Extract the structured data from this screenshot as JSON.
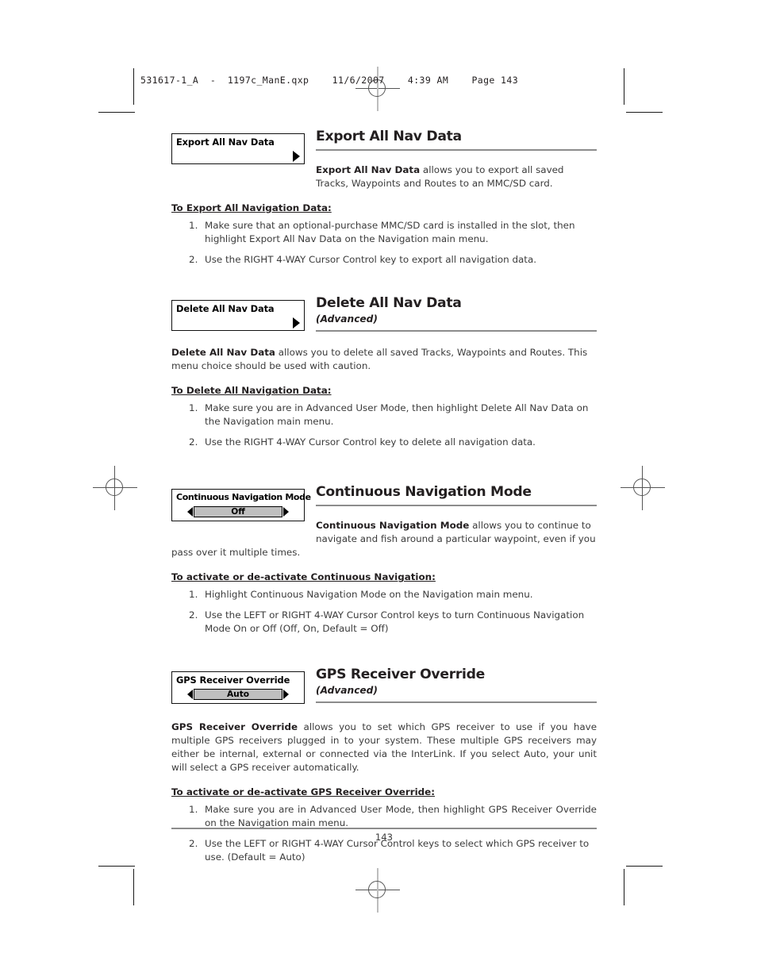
{
  "prepress": {
    "filestamp": "531617-1_A  -  1197c_ManE.qxp    11/6/2007    4:39 AM    Page 143"
  },
  "footer": {
    "page_number": "143"
  },
  "sections": [
    {
      "id": "export-all-nav-data",
      "widget": {
        "label": "Export All Nav Data",
        "type": "submenu",
        "arrow": "triangle-right"
      },
      "title": "Export All Nav Data",
      "subtitle": "",
      "body_bold": "Export All Nav Data",
      "body_rest": " allows you to export all saved Tracks, Waypoints and Routes to an MMC/SD card.",
      "howto": "To Export All Navigation Data:",
      "steps": [
        "Make sure that an optional-purchase MMC/SD card is installed in the slot, then highlight Export All Nav Data on the Navigation main menu.",
        "Use the RIGHT 4-WAY Cursor Control key to export all navigation data."
      ]
    },
    {
      "id": "delete-all-nav-data",
      "widget": {
        "label": "Delete All Nav Data",
        "type": "submenu",
        "arrow": "triangle-right"
      },
      "title": "Delete All Nav Data",
      "subtitle": "(Advanced)",
      "body_bold": "Delete All Nav Data",
      "body_rest": " allows you to delete all saved Tracks, Waypoints and Routes. This menu choice should be used with caution.",
      "howto": "To Delete All Navigation Data:",
      "steps": [
        "Make sure you are in Advanced User Mode, then highlight Delete All Nav Data on the Navigation main menu.",
        "Use the RIGHT 4-WAY Cursor Control key to delete all navigation data."
      ]
    },
    {
      "id": "continuous-navigation-mode",
      "widget": {
        "label": "Continuous Navigation Mode",
        "type": "slider",
        "value": "Off",
        "left_arrow": "triangle-left",
        "right_arrow": "triangle-right"
      },
      "title": "Continuous Navigation Mode",
      "subtitle": "",
      "body_bold": "Continuous Navigation Mode",
      "body_rest": " allows you to continue to navigate and fish around a particular waypoint, even if you pass over it multiple times.",
      "howto": "To activate or de-activate Continuous Navigation:",
      "steps": [
        "Highlight Continuous Navigation Mode on the Navigation main menu.",
        "Use the LEFT or RIGHT 4-WAY Cursor Control keys to turn Continuous Navigation Mode On or Off (Off, On, Default = Off)"
      ]
    },
    {
      "id": "gps-receiver-override",
      "widget": {
        "label": "GPS Receiver Override",
        "type": "slider",
        "value": "Auto",
        "left_arrow": "triangle-left",
        "right_arrow": "triangle-right"
      },
      "title": "GPS Receiver Override",
      "subtitle": "(Advanced)",
      "body_bold": "GPS Receiver Override",
      "body_rest": " allows you to set which GPS receiver to use if you have multiple GPS receivers plugged in to your system. These multiple GPS receivers may either be internal, external or connected via the InterLink. If you select Auto, your unit will select a GPS receiver automatically.",
      "howto": "To activate or de-activate GPS Receiver Override:",
      "steps": [
        "Make sure you are in Advanced User Mode, then highlight GPS Receiver Override on the Navigation main menu.",
        "Use the LEFT or RIGHT 4-WAY Cursor Control keys to select which GPS receiver to use. (Default = Auto)"
      ]
    }
  ],
  "step_numbers": [
    "1.",
    "2."
  ]
}
